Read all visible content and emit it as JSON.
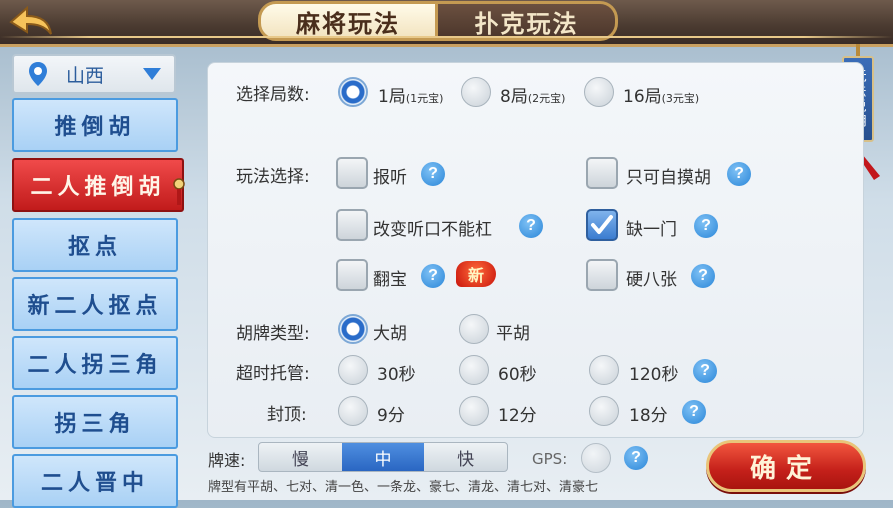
{
  "header": {
    "tabs": [
      {
        "label": "麻将玩法",
        "active": true
      },
      {
        "label": "扑克玩法",
        "active": false
      }
    ],
    "back_icon": "back-arrow-icon"
  },
  "sidebar": {
    "region": "山西",
    "items": [
      {
        "label": "推倒胡",
        "active": false
      },
      {
        "label": "二人推倒胡",
        "active": true
      },
      {
        "label": "抠点",
        "active": false
      },
      {
        "label": "新二人抠点",
        "active": false
      },
      {
        "label": "二人拐三角",
        "active": false
      },
      {
        "label": "拐三角",
        "active": false
      },
      {
        "label": "二人晋中",
        "active": false
      }
    ]
  },
  "rules_tab": "玩法说明",
  "settings": {
    "rounds": {
      "label": "选择局数:",
      "options": [
        {
          "main": "1局",
          "sub": "(1元宝)",
          "selected": true
        },
        {
          "main": "8局",
          "sub": "(2元宝)",
          "selected": false
        },
        {
          "main": "16局",
          "sub": "(3元宝)",
          "selected": false
        }
      ]
    },
    "play": {
      "label": "玩法选择:",
      "options": [
        {
          "label": "报听",
          "checked": false
        },
        {
          "label": "只可自摸胡",
          "checked": false
        },
        {
          "label": "改变听口不能杠",
          "checked": false
        },
        {
          "label": "缺一门",
          "checked": true
        },
        {
          "label": "翻宝",
          "checked": false,
          "badge": "新"
        },
        {
          "label": "硬八张",
          "checked": false
        }
      ]
    },
    "hu_type": {
      "label": "胡牌类型:",
      "options": [
        {
          "label": "大胡",
          "selected": true
        },
        {
          "label": "平胡",
          "selected": false
        }
      ]
    },
    "timeout": {
      "label": "超时托管:",
      "options": [
        {
          "label": "30秒",
          "selected": false
        },
        {
          "label": "60秒",
          "selected": false
        },
        {
          "label": "120秒",
          "selected": false
        }
      ]
    },
    "cap": {
      "label": "封顶:",
      "options": [
        {
          "label": "9分",
          "selected": false
        },
        {
          "label": "12分",
          "selected": false
        },
        {
          "label": "18分",
          "selected": false
        }
      ]
    }
  },
  "speed": {
    "label": "牌速:",
    "options": [
      "慢",
      "中",
      "快"
    ],
    "selected": "中"
  },
  "gps_label": "GPS:",
  "bottom_text": "牌型有平胡、七对、清一色、一条龙、豪七、清龙、清七对、清豪七",
  "confirm_label": "确定",
  "colors": {
    "accent_blue": "#2a6cc9",
    "confirm_red": "#c4201a",
    "gold": "#c49a52"
  }
}
